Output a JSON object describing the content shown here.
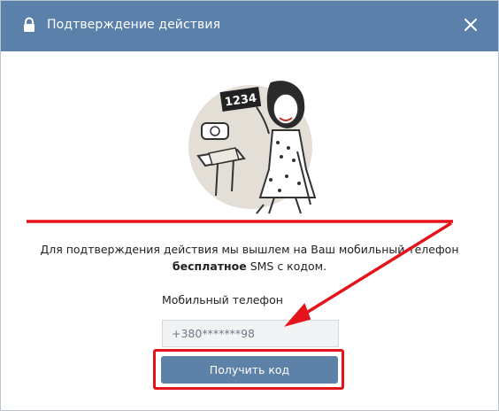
{
  "dialog": {
    "title": "Подтверждение действия",
    "lock_icon": "lock-icon",
    "close_icon": "close-icon"
  },
  "illustration": {
    "card_text": "1234"
  },
  "message": {
    "line1": "Для подтверждения действия мы вышлем на Ваш мобильный телефон",
    "bold": "бесплатное",
    "rest": " SMS с кодом."
  },
  "phone": {
    "label": "Мобильный телефон",
    "value": "+380*******98"
  },
  "submit": {
    "label": "Получить код"
  },
  "colors": {
    "header": "#5b81ab",
    "button": "#5e81a8",
    "annotation": "#e4131c"
  }
}
